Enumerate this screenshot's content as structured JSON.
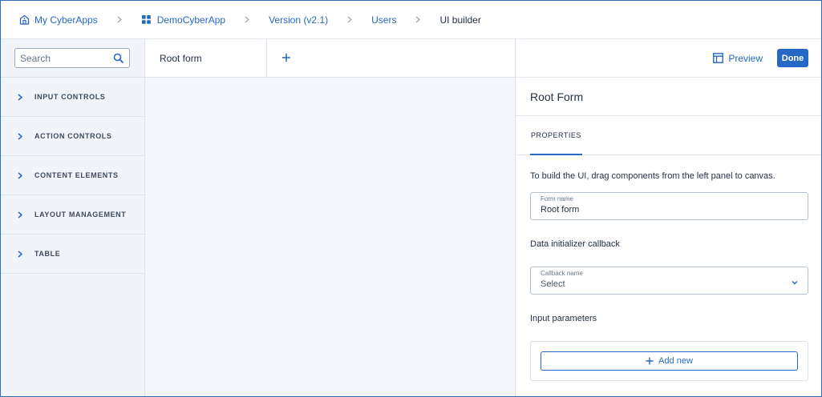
{
  "breadcrumb": [
    {
      "label": "My CyberApps",
      "icon": "building-icon"
    },
    {
      "label": "DemoCyberApp",
      "icon": "apps-grid-icon"
    },
    {
      "label": "Version (v2.1)"
    },
    {
      "label": "Users"
    },
    {
      "label": "UI builder",
      "current": true
    }
  ],
  "left_panel": {
    "search_placeholder": "Search",
    "categories": [
      {
        "label": "INPUT CONTROLS"
      },
      {
        "label": "ACTION CONTROLS"
      },
      {
        "label": "CONTENT ELEMENTS"
      },
      {
        "label": "LAYOUT MANAGEMENT"
      },
      {
        "label": "TABLE"
      }
    ]
  },
  "canvas": {
    "tabs": [
      {
        "label": "Root form"
      }
    ]
  },
  "right_panel": {
    "preview_label": "Preview",
    "done_label": "Done",
    "title": "Root Form",
    "tab_label": "PROPERTIES",
    "hint": "To build the UI, drag components from the left panel to canvas.",
    "form_name": {
      "label": "Form name",
      "value": "Root form"
    },
    "data_initializer_heading": "Data initializer callback",
    "callback_name": {
      "label": "Callback name",
      "value": "Select"
    },
    "input_params_heading": "Input parameters",
    "add_new_label": "Add new"
  },
  "colors": {
    "accent": "#2668c5",
    "sidebar_bg": "#f1f4fa",
    "canvas_bg": "#f3f6fb",
    "border": "#dde3ec"
  }
}
